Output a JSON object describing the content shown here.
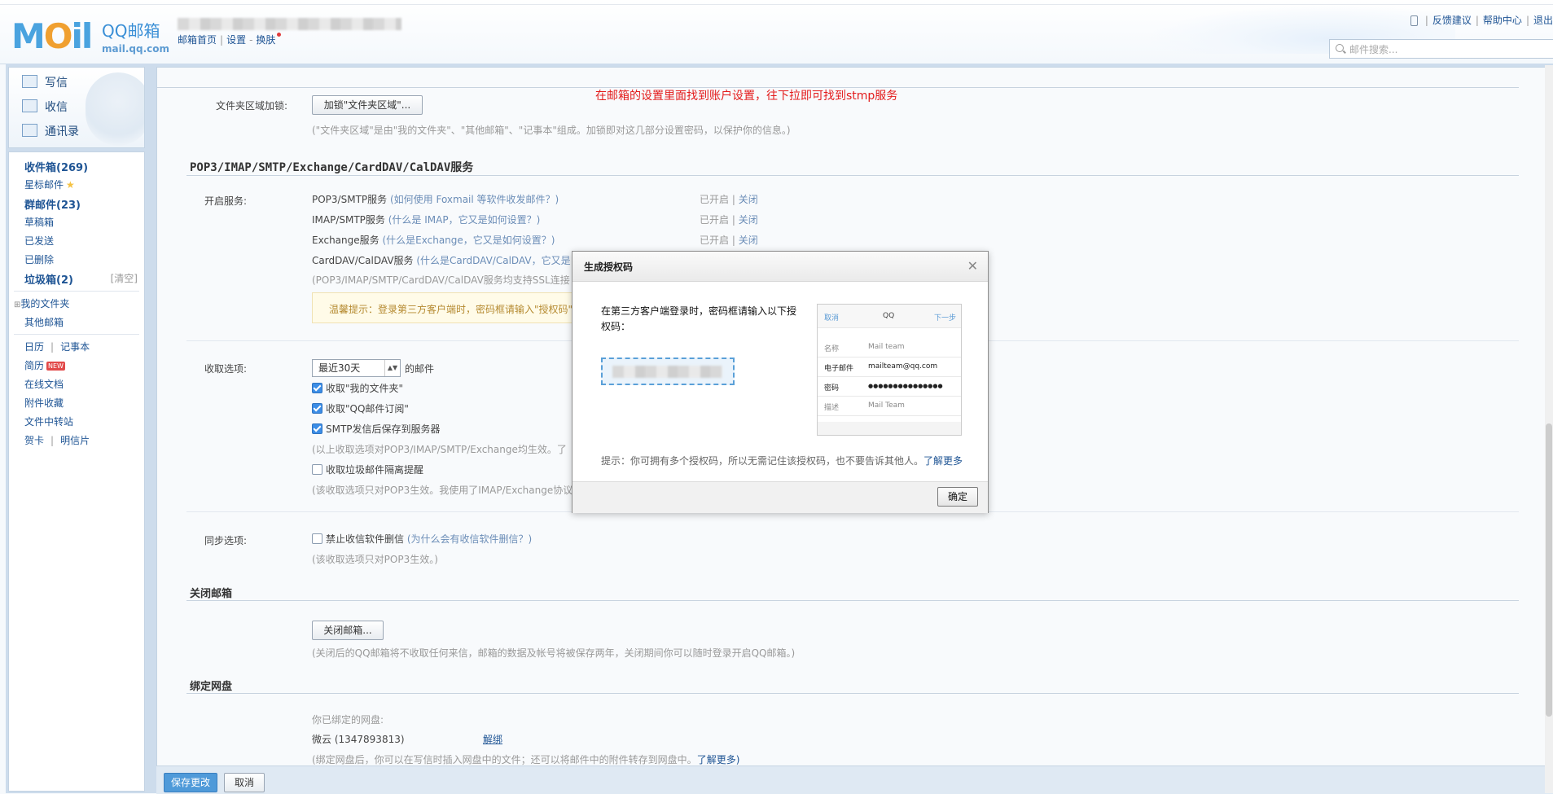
{
  "header": {
    "logo_text": "MOil",
    "brand_name": "QQ邮箱",
    "brand_domain": "mail.qq.com",
    "links": [
      "邮箱首页",
      "设置",
      "换肤"
    ],
    "right_links": [
      "反馈建议",
      "帮助中心",
      "退出"
    ],
    "search_placeholder": "邮件搜索..."
  },
  "annotation": "在邮箱的设置里面找到账户设置，往下拉即可找到stmp服务",
  "compose": {
    "write": "写信",
    "receive": "收信",
    "contacts": "通讯录"
  },
  "folders": {
    "inbox": "收件箱(269)",
    "starred": "星标邮件",
    "group": "群邮件(23)",
    "drafts": "草稿箱",
    "sent": "已发送",
    "deleted": "已删除",
    "spam": "垃圾箱(2)",
    "spam_clear": "[清空]",
    "my_folders": "我的文件夹",
    "other": "其他邮箱",
    "calendar": "日历",
    "notes": "记事本",
    "resume": "简历",
    "new_badge": "NEW",
    "docs": "在线文档",
    "attachments": "附件收藏",
    "transfer": "文件中转站",
    "card": "贺卡",
    "postcard": "明信片"
  },
  "folder_lock": {
    "label": "文件夹区域加锁:",
    "button": "加锁\"文件夹区域\"...",
    "hint": "(\"文件夹区域\"是由\"我的文件夹\"、\"其他邮箱\"、\"记事本\"组成。加锁即对这几部分设置密码，以保护你的信息。)"
  },
  "services": {
    "title": "POP3/IMAP/SMTP/Exchange/CardDAV/CalDAV服务",
    "label": "开启服务:",
    "rows": [
      {
        "name": "POP3/SMTP服务",
        "help": "(如何使用 Foxmail 等软件收发邮件？)",
        "status": "已开启",
        "action": "关闭"
      },
      {
        "name": "IMAP/SMTP服务",
        "help": "(什么是 IMAP，它又是如何设置？)",
        "status": "已开启",
        "action": "关闭"
      },
      {
        "name": "Exchange服务",
        "help": "(什么是Exchange，它又是如何设置？)",
        "status": "已开启",
        "action": "关闭"
      },
      {
        "name": "CardDAV/CalDAV服务",
        "help": "(什么是CardDAV/CalDAV，它又是",
        "status": "",
        "action": ""
      }
    ],
    "ssl_hint": "(POP3/IMAP/SMTP/CardDAV/CalDAV服务均支持SSL连接",
    "tip": "温馨提示：登录第三方客户端时，密码框请输入\"授权码\""
  },
  "receive_opts": {
    "label": "收取选项:",
    "select_value": "最近30天",
    "select_suffix": "的邮件",
    "opt1": "收取\"我的文件夹\"",
    "opt2": "收取\"QQ邮件订阅\"",
    "opt3": "SMTP发信后保存到服务器",
    "hint1": "(以上收取选项对POP3/IMAP/SMTP/Exchange均生效。了",
    "opt4": "收取垃圾邮件隔离提醒",
    "hint2": "(该收取选项只对POP3生效。我使用了IMAP/Exchange协议"
  },
  "sync_opts": {
    "label": "同步选项:",
    "opt": "禁止收信软件删信",
    "help": "(为什么会有收信软件删信？)",
    "hint": "(该收取选项只对POP3生效。)"
  },
  "close_mailbox": {
    "title": "关闭邮箱",
    "button": "关闭邮箱...",
    "hint": "(关闭后的QQ邮箱将不收取任何来信，邮箱的数据及帐号将被保存两年，关闭期间你可以随时登录开启QQ邮箱。)"
  },
  "netdisk": {
    "title": "绑定网盘",
    "bound_label": "你已绑定的网盘:",
    "account": "微云 (1347893813)",
    "unbind": "解绑",
    "hint": "(绑定网盘后，你可以在写信时插入网盘中的文件；还可以将邮件中的附件转存到网盘中。",
    "more": "了解更多)"
  },
  "bottom": {
    "save": "保存更改",
    "cancel": "取消"
  },
  "modal": {
    "title": "生成授权码",
    "desc": "在第三方客户端登录时，密码框请输入以下授权码：",
    "phone": {
      "cancel": "取消",
      "center": "QQ",
      "next": "下一步",
      "rows": [
        {
          "k": "名称",
          "v": "Mail team"
        },
        {
          "k": "电子邮件",
          "v": "mailteam@qq.com"
        },
        {
          "k": "密码",
          "v": "●●●●●●●●●●●●●●●"
        },
        {
          "k": "描述",
          "v": "Mail Team"
        }
      ]
    },
    "tip": "提示：你可拥有多个授权码，所以无需记住该授权码，也不要告诉其他人。",
    "tip_link": "了解更多",
    "ok": "确定"
  },
  "colors": {
    "link": "#1e5494",
    "annotation": "#e31b1b",
    "save_button": "#4f9ad9"
  }
}
